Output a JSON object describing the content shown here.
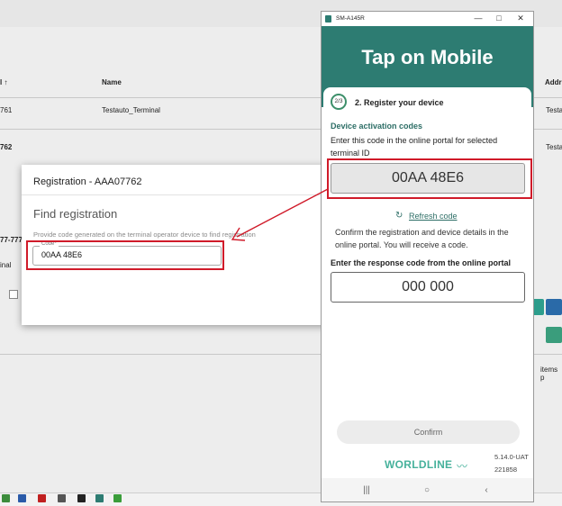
{
  "background": {
    "col_id_header": "l ↑",
    "col_name_header": "Name",
    "col_addr_header": "Addr",
    "row1_id": "761",
    "row1_name": "Testauto_Terminal",
    "row1_addr": "Testa",
    "row2_id": "762",
    "row2_addr": "Testa",
    "side_text": "77-777",
    "side_text2": "inal",
    "footer_text": "items p"
  },
  "dialog": {
    "title": "Registration - AAA07762",
    "find_heading": "Find registration",
    "hint": "Provide code generated on the terminal operator device to find registration",
    "code_label": "Code*",
    "code_value": "00AA 48E6"
  },
  "phone": {
    "window_title": "SM-A145R",
    "header_title": "Tap on Mobile",
    "step_badge": "2/3",
    "step_title": "2. Register your device",
    "section_title": "Device activation codes",
    "instruction": "Enter this code in the online portal for selected terminal ID",
    "activation_code": "00AA 48E6",
    "refresh_label": "Refresh code",
    "confirm_text": "Confirm the registration and device details in the online portal. You will receive a code.",
    "response_label": "Enter the response code from the online portal",
    "response_placeholder": "000 000",
    "confirm_button": "Confirm",
    "brand": "WORLDLINE",
    "version_line1": "5.14.0-UAT",
    "version_line2": "221858"
  },
  "colors": {
    "teal": "#2d7c72",
    "highlight_red": "#d01b2a",
    "brand_green": "#46b19b"
  }
}
